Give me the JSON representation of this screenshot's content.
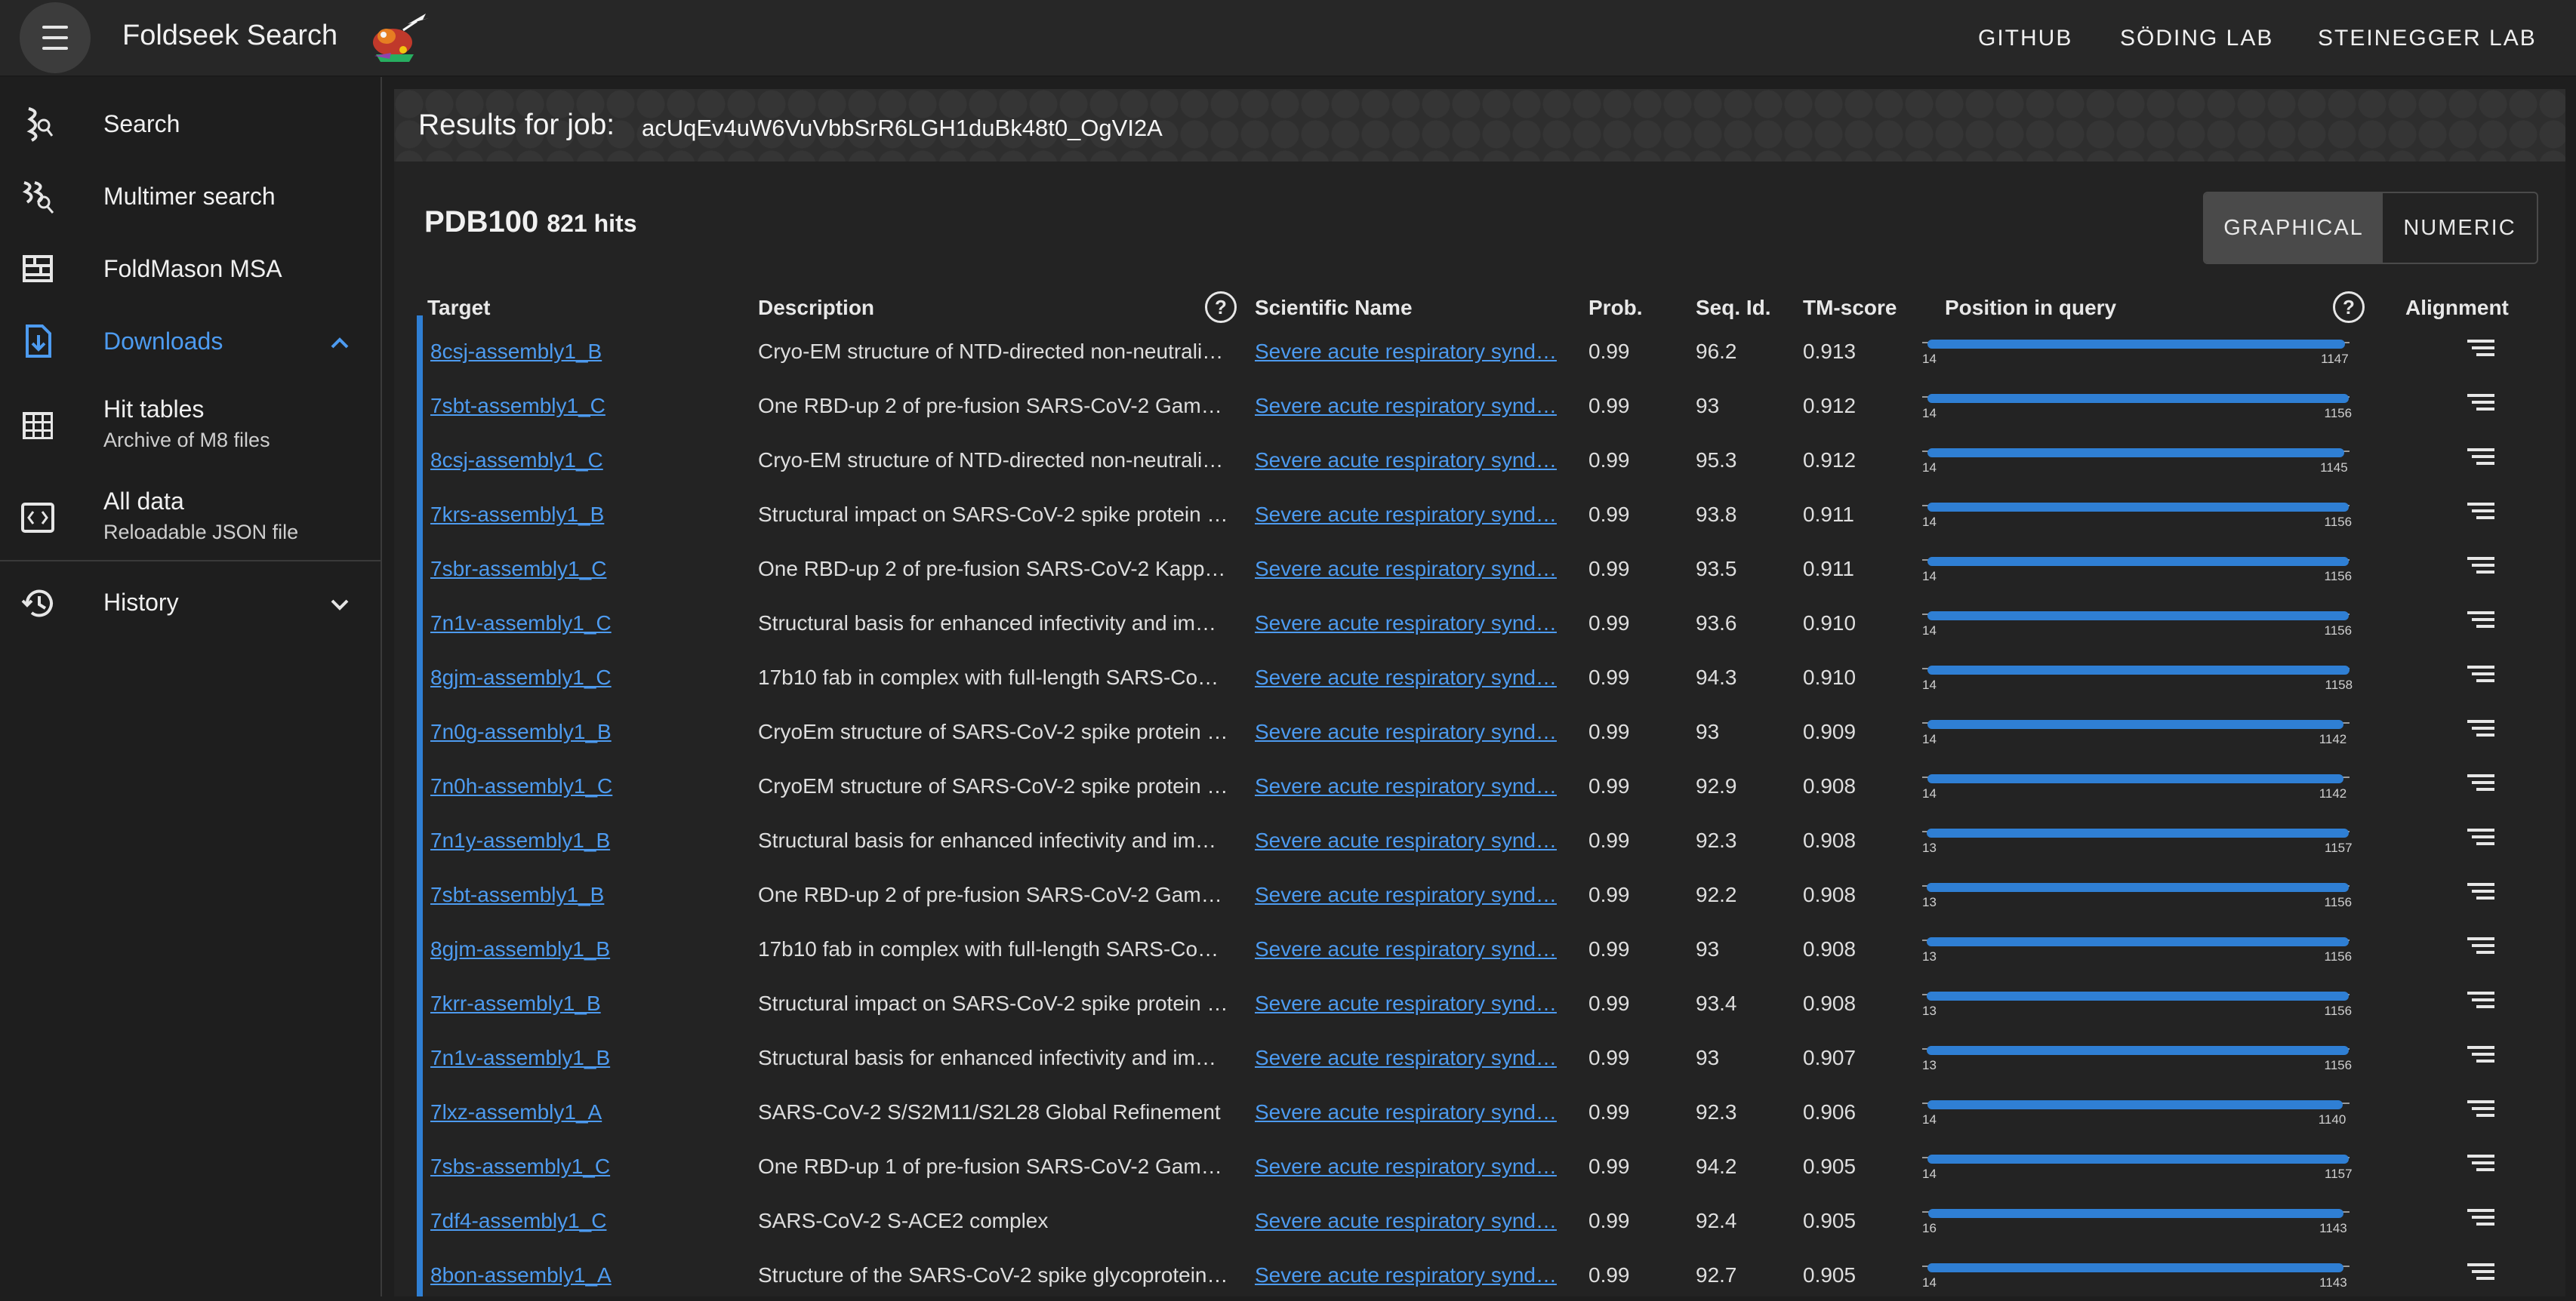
{
  "app": {
    "title": "Foldseek Search",
    "nav": [
      "GITHUB",
      "SÖDING LAB",
      "STEINEGGER LAB"
    ]
  },
  "sidebar": {
    "search": "Search",
    "multimer": "Multimer search",
    "foldmason": "FoldMason MSA",
    "downloads": "Downloads",
    "hit_tables": "Hit tables",
    "hit_tables_sub": "Archive of M8 files",
    "all_data": "All data",
    "all_data_sub": "Reloadable JSON file",
    "history": "History"
  },
  "results": {
    "label": "Results for job:",
    "job_id": "acUqEv4uW6VuVbbSrR6LGH1duBk48t0_OgVI2A",
    "db_name": "PDB100",
    "hits": "821 hits",
    "view_graphical": "GRAPHICAL",
    "view_numeric": "NUMERIC"
  },
  "columns": {
    "target": "Target",
    "description": "Description",
    "sci_name": "Scientific Name",
    "prob": "Prob.",
    "seq_id": "Seq. Id.",
    "tm": "TM-score",
    "position": "Position in query",
    "alignment": "Alignment"
  },
  "colors": {
    "accent": "#2f7fd4",
    "link": "#4d9bf0"
  },
  "rows": [
    {
      "target": "8csj-assembly1_B",
      "desc": "Cryo-EM structure of NTD-directed non-neutrali…",
      "sci": "Severe acute respiratory synd…",
      "prob": "0.99",
      "seq": "96.2",
      "tm": "0.913",
      "qstart": "14",
      "qend": "1147",
      "qlen": 1159
    },
    {
      "target": "7sbt-assembly1_C",
      "desc": "One RBD-up 2 of pre-fusion SARS-CoV-2 Gam…",
      "sci": "Severe acute respiratory synd…",
      "prob": "0.99",
      "seq": "93",
      "tm": "0.912",
      "qstart": "14",
      "qend": "1156",
      "qlen": 1159
    },
    {
      "target": "8csj-assembly1_C",
      "desc": "Cryo-EM structure of NTD-directed non-neutrali…",
      "sci": "Severe acute respiratory synd…",
      "prob": "0.99",
      "seq": "95.3",
      "tm": "0.912",
      "qstart": "14",
      "qend": "1145",
      "qlen": 1159
    },
    {
      "target": "7krs-assembly1_B",
      "desc": "Structural impact on SARS-CoV-2 spike protein …",
      "sci": "Severe acute respiratory synd…",
      "prob": "0.99",
      "seq": "93.8",
      "tm": "0.911",
      "qstart": "14",
      "qend": "1156",
      "qlen": 1159
    },
    {
      "target": "7sbr-assembly1_C",
      "desc": "One RBD-up 2 of pre-fusion SARS-CoV-2 Kapp…",
      "sci": "Severe acute respiratory synd…",
      "prob": "0.99",
      "seq": "93.5",
      "tm": "0.911",
      "qstart": "14",
      "qend": "1156",
      "qlen": 1159
    },
    {
      "target": "7n1v-assembly1_C",
      "desc": "Structural basis for enhanced infectivity and im…",
      "sci": "Severe acute respiratory synd…",
      "prob": "0.99",
      "seq": "93.6",
      "tm": "0.910",
      "qstart": "14",
      "qend": "1156",
      "qlen": 1159
    },
    {
      "target": "8gjm-assembly1_C",
      "desc": "17b10 fab in complex with full-length SARS-Co…",
      "sci": "Severe acute respiratory synd…",
      "prob": "0.99",
      "seq": "94.3",
      "tm": "0.910",
      "qstart": "14",
      "qend": "1158",
      "qlen": 1159
    },
    {
      "target": "7n0g-assembly1_B",
      "desc": "CryoEm structure of SARS-CoV-2 spike protein …",
      "sci": "Severe acute respiratory synd…",
      "prob": "0.99",
      "seq": "93",
      "tm": "0.909",
      "qstart": "14",
      "qend": "1142",
      "qlen": 1159
    },
    {
      "target": "7n0h-assembly1_C",
      "desc": "CryoEM structure of SARS-CoV-2 spike protein …",
      "sci": "Severe acute respiratory synd…",
      "prob": "0.99",
      "seq": "92.9",
      "tm": "0.908",
      "qstart": "14",
      "qend": "1142",
      "qlen": 1159
    },
    {
      "target": "7n1y-assembly1_B",
      "desc": "Structural basis for enhanced infectivity and im…",
      "sci": "Severe acute respiratory synd…",
      "prob": "0.99",
      "seq": "92.3",
      "tm": "0.908",
      "qstart": "13",
      "qend": "1157",
      "qlen": 1159
    },
    {
      "target": "7sbt-assembly1_B",
      "desc": "One RBD-up 2 of pre-fusion SARS-CoV-2 Gam…",
      "sci": "Severe acute respiratory synd…",
      "prob": "0.99",
      "seq": "92.2",
      "tm": "0.908",
      "qstart": "13",
      "qend": "1156",
      "qlen": 1159
    },
    {
      "target": "8gjm-assembly1_B",
      "desc": "17b10 fab in complex with full-length SARS-Co…",
      "sci": "Severe acute respiratory synd…",
      "prob": "0.99",
      "seq": "93",
      "tm": "0.908",
      "qstart": "13",
      "qend": "1156",
      "qlen": 1159
    },
    {
      "target": "7krr-assembly1_B",
      "desc": "Structural impact on SARS-CoV-2 spike protein …",
      "sci": "Severe acute respiratory synd…",
      "prob": "0.99",
      "seq": "93.4",
      "tm": "0.908",
      "qstart": "13",
      "qend": "1156",
      "qlen": 1159
    },
    {
      "target": "7n1v-assembly1_B",
      "desc": "Structural basis for enhanced infectivity and im…",
      "sci": "Severe acute respiratory synd…",
      "prob": "0.99",
      "seq": "93",
      "tm": "0.907",
      "qstart": "13",
      "qend": "1156",
      "qlen": 1159
    },
    {
      "target": "7lxz-assembly1_A",
      "desc": "SARS-CoV-2 S/S2M11/S2L28 Global Refinement",
      "sci": "Severe acute respiratory synd…",
      "prob": "0.99",
      "seq": "92.3",
      "tm": "0.906",
      "qstart": "14",
      "qend": "1140",
      "qlen": 1159
    },
    {
      "target": "7sbs-assembly1_C",
      "desc": "One RBD-up 1 of pre-fusion SARS-CoV-2 Gam…",
      "sci": "Severe acute respiratory synd…",
      "prob": "0.99",
      "seq": "94.2",
      "tm": "0.905",
      "qstart": "14",
      "qend": "1157",
      "qlen": 1159
    },
    {
      "target": "7df4-assembly1_C",
      "desc": "SARS-CoV-2 S-ACE2 complex",
      "sci": "Severe acute respiratory synd…",
      "prob": "0.99",
      "seq": "92.4",
      "tm": "0.905",
      "qstart": "16",
      "qend": "1143",
      "qlen": 1159
    },
    {
      "target": "8bon-assembly1_A",
      "desc": "Structure of the SARS-CoV-2 spike glycoprotein…",
      "sci": "Severe acute respiratory synd…",
      "prob": "0.99",
      "seq": "92.7",
      "tm": "0.905",
      "qstart": "14",
      "qend": "1143",
      "qlen": 1159
    }
  ]
}
